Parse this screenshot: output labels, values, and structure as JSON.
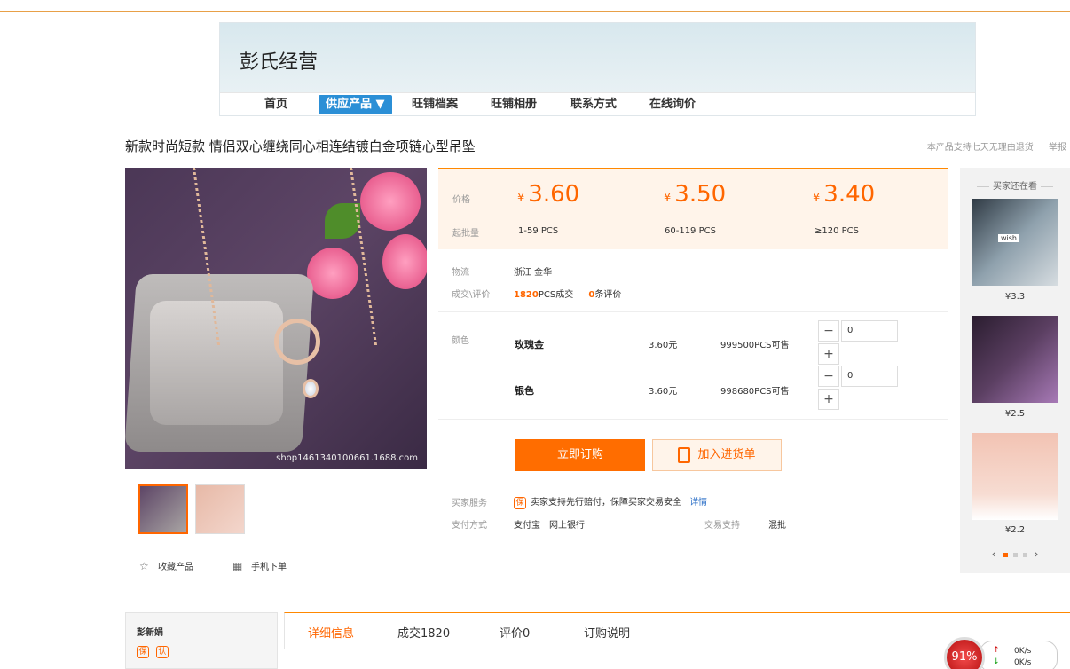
{
  "shop": {
    "name": "彭氏经营",
    "nav": [
      "首页",
      "供应产品 ▼",
      "旺铺档案",
      "旺铺相册",
      "联系方式",
      "在线询价"
    ]
  },
  "product": {
    "title": "新款时尚短款 情侣双心缠绕同心相连结镀白金项链心型吊坠",
    "topright": [
      "本产品支持七天无理由退货",
      "举报"
    ],
    "watermark": "shop1461340100661.1688.com"
  },
  "pricing": {
    "price_label": "价格",
    "qty_label": "起批量",
    "currency": "¥",
    "tiers": [
      {
        "price": "3.60",
        "range": "1-59 PCS"
      },
      {
        "price": "3.50",
        "range": "60-119 PCS"
      },
      {
        "price": "3.40",
        "range": "≥120 PCS"
      }
    ]
  },
  "logistics": {
    "label": "物流",
    "value": "浙江 金华"
  },
  "sales": {
    "label": "成交\\评价",
    "count": "1820",
    "count_suffix": "PCS成交",
    "reviews": "0",
    "reviews_suffix": "条评价"
  },
  "sku": {
    "label": "颜色",
    "items": [
      {
        "name": "玫瑰金",
        "price": "3.60元",
        "stock": "999500PCS可售",
        "qty": "0"
      },
      {
        "name": "银色",
        "price": "3.60元",
        "stock": "998680PCS可售",
        "qty": "0"
      }
    ],
    "minus": "−",
    "plus": "+"
  },
  "actions": {
    "order": "立即订购",
    "cart": "加入进货单"
  },
  "service": {
    "buyer_label": "买家服务",
    "buyer_icon": "保",
    "buyer_text": "卖家支持先行赔付，保障买家交易安全",
    "buyer_link": "详情",
    "pay_label": "支付方式",
    "pay_values": "支付宝　网上银行",
    "trade_label": "交易支持",
    "trade_value": "混批"
  },
  "left_actions": {
    "fav": "收藏产品",
    "mobile": "手机下单"
  },
  "sidebar": {
    "title": "买家还在看",
    "prices": [
      "¥3.3",
      "¥2.5",
      "¥2.2"
    ],
    "img1_text": "wish"
  },
  "seller": {
    "name": "彭新娟",
    "badges": [
      "保",
      "认"
    ]
  },
  "tabs": [
    "详细信息",
    "成交1820",
    "评价0",
    "订购说明"
  ],
  "widget": {
    "percent": "91%",
    "up": "↑",
    "down": "↓",
    "up_speed": "0K/s",
    "down_speed": "0K/s",
    "plus": "+"
  },
  "colors": {
    "accent": "#ff6d00",
    "nav_active": "#2b8fd6",
    "link": "#2b6fc7"
  }
}
